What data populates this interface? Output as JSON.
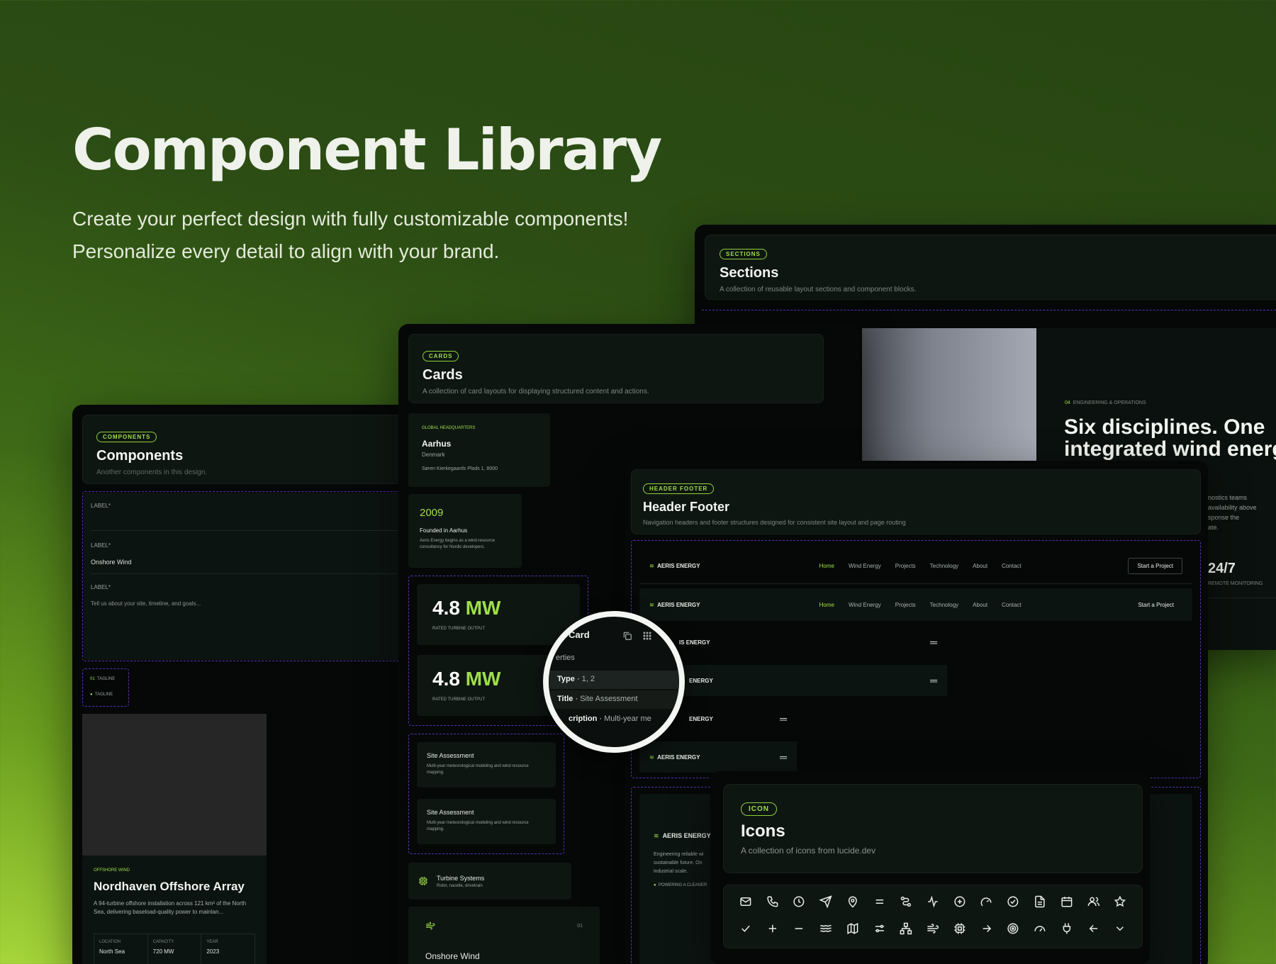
{
  "hero": {
    "title": "Component Library",
    "subtitle": "Create your perfect design with fully customizable components! Personalize every detail to align with your brand."
  },
  "sections": {
    "tag": "SECTIONS",
    "title": "Sections",
    "desc": "A collection of reusable layout sections and component blocks.",
    "eyebrow": "04",
    "eyebrow_label": "ENGINEERING & OPERATIONS",
    "headline1": "Six disciplines. One",
    "headline2": "integrated wind energ",
    "side_text1": "nostics teams",
    "side_text2": "availability above",
    "side_text3": "sponse the",
    "side_text4": "ate.",
    "stat": "24/7",
    "stat_label": "REMOTE MONITORING"
  },
  "components": {
    "tag": "COMPONENTS",
    "title": "Components",
    "desc": "Another components in this design.",
    "label1": "LABEL*",
    "label2": "LABEL*",
    "value2": "Onshore Wind",
    "label3": "LABEL*",
    "placeholder3": "Tell us about your site, timeline, and goals...",
    "tagline_num": "01",
    "tagline": "TAGLINE",
    "tagline2": "TAGLINE",
    "project_eyebrow": "OFFSHORE WIND",
    "project_title": "Nordhaven Offshore Array",
    "project_desc": "A 94-turbine offshore installation across 121 km² of the North Sea, delivering baseload-quality power to mainlan...",
    "meta": [
      {
        "k": "LOCATION",
        "v": "North Sea"
      },
      {
        "k": "CAPACITY",
        "v": "720 MW"
      },
      {
        "k": "YEAR",
        "v": "2023"
      }
    ]
  },
  "cards": {
    "tag": "CARDS",
    "title": "Cards",
    "desc": "A collection of card layouts for displaying structured content and actions.",
    "hq_eyebrow": "GLOBAL HEADQUARTERS",
    "hq_city": "Aarhus",
    "hq_country": "Denmark",
    "hq_address": "Søren Kierkegaards Plads 1, 8000",
    "year": "2009",
    "founded": "Founded in Aarhus",
    "founded_desc": "Aeris Energy begins as a wind-resource consultancy for Nordic developers.",
    "stat_value": "4.8",
    "stat_unit": "MW",
    "stat_label": "RATED TURBINE OUTPUT",
    "stat2_value": "4.8",
    "stat2_unit": "MW",
    "stat2_label": "RATED TURBINE OUTPUT",
    "site1_title": "Site Assessment",
    "site1_desc": "Multi-year meteorological modeling and wind resource mapping.",
    "site2_title": "Site Assessment",
    "site2_desc": "Multi-year meteorological modeling and wind resource mapping.",
    "turbine_title": "Turbine Systems",
    "turbine_desc": "Rotor, nacelle, drivetrain",
    "onshore_num": "01",
    "onshore_title": "Onshore Wind"
  },
  "magnifier": {
    "title": "Card",
    "props": "erties",
    "row1_key": "Type",
    "row1_val": "1, 2",
    "row2_key": "Title",
    "row2_val": "Site Assessment",
    "row3_key": "cription",
    "row3_val": "Multi-year me"
  },
  "headerfooter": {
    "tag": "HEADER FOOTER",
    "title": "Header Footer",
    "desc": "Navigation headers and footer structures designed for consistent site layout and page routing",
    "brand": "AERIS ENERGY",
    "brand_short": "IS ENERGY",
    "brand_short2": "ENERGY",
    "links": [
      "Home",
      "Wind Energy",
      "Projects",
      "Technology",
      "About",
      "Contact"
    ],
    "cta": "Start a Project",
    "footer_text1": "Engineering reliable wi",
    "footer_text2": "sustainable future. On",
    "footer_text3": "industrial scale.",
    "footer_bullet": "POWERING A CLEANER"
  },
  "icons": {
    "tag": "ICON",
    "title": "Icons",
    "desc": "A collection of icons from lucide.dev"
  }
}
